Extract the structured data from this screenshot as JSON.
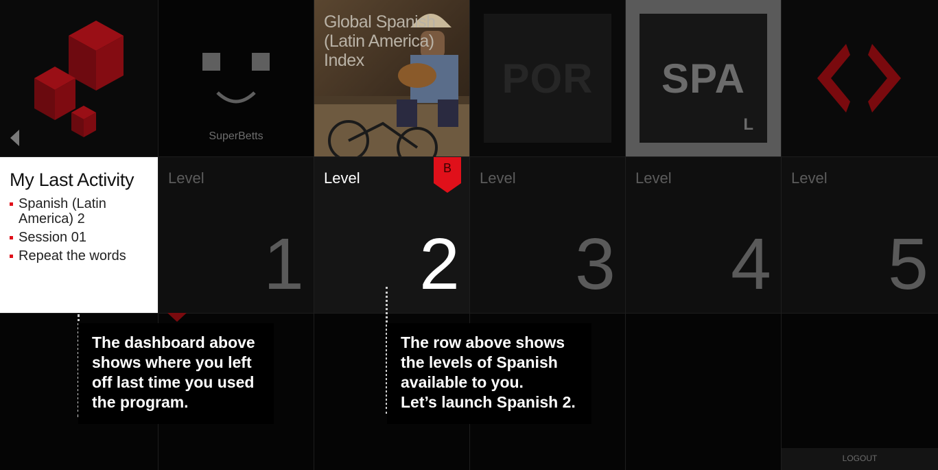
{
  "tiles": {
    "superbetts_label": "SuperBetts",
    "index_title": "Global Spanish (Latin America) Index",
    "por_code": "POR",
    "spa_code": "SPA",
    "spa_sub": "L"
  },
  "activity": {
    "title": "My Last Activity",
    "items": [
      "Spanish (Latin America) 2",
      "Session 01",
      "Repeat the words"
    ]
  },
  "levels": [
    {
      "label": "Level",
      "number": "1"
    },
    {
      "label": "Level",
      "number": "2",
      "badge": "B"
    },
    {
      "label": "Level",
      "number": "3"
    },
    {
      "label": "Level",
      "number": "4"
    },
    {
      "label": "Level",
      "number": "5"
    }
  ],
  "callouts": {
    "dashboard": "The dashboard above shows where you left off last time you used the program.",
    "levels_lines": [
      "The row above shows",
      "the levels of Spanish",
      "available to you.",
      "Let’s launch Spanish 2."
    ]
  },
  "logout": "LOGOUT",
  "colors": {
    "accent_red": "#e0101a",
    "dark_red": "#7a0a0e"
  }
}
